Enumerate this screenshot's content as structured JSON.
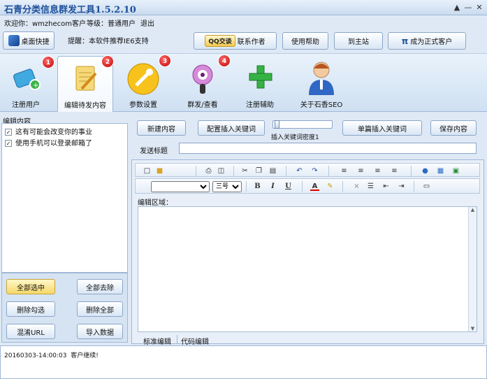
{
  "app": {
    "title": "石青分类信息群发工具1.5.2.10",
    "window_buttons": [
      "▲",
      "—",
      "✕"
    ]
  },
  "menubar": {
    "welcome": "欢迎你：wmzhecom客户",
    "level": "等级：普通用户",
    "logout": "退出"
  },
  "toolbar": {
    "desktop_shortcut": "桌面快捷",
    "hint": "提醒：本软件推荐IE6支持",
    "qq_badge": "QQ交谈",
    "contact_author": "联系作者",
    "help": "使用帮助",
    "home": "到主站",
    "become_customer": "成为正式客户",
    "pi_symbol": "π"
  },
  "tabs": [
    {
      "label": "注册用户",
      "badge": "1"
    },
    {
      "label": "编辑待发内容",
      "badge": "2"
    },
    {
      "label": "参数设置",
      "badge": "3"
    },
    {
      "label": "群发/查看",
      "badge": "4"
    },
    {
      "label": "注册辅助"
    },
    {
      "label": "关于石香SEO"
    }
  ],
  "left_panel": {
    "title": "编辑内容",
    "items": [
      "这有可能会改变你的事业",
      "使用手机可以登录邮箱了"
    ],
    "buttons": {
      "select_all": "全部选中",
      "clear_all": "全部去除",
      "delete_checked": "删除勾选",
      "delete_all": "删除全部",
      "filter_url": "混淆URL",
      "import_data": "导入数据"
    }
  },
  "editor": {
    "new_content": "新建内容",
    "config_keywords": "配置插入关键词",
    "keyword_density": "插入关键词密度1",
    "single_insert": "单篇插入关键词",
    "save_content": "保存内容",
    "subject_label": "发送标题",
    "subject_value": "",
    "area_label": "编辑区域：",
    "font_size": "三号",
    "font_name": "",
    "bold": "B",
    "italic": "I",
    "underline": "U",
    "text_color": "A",
    "tabs": [
      "标准编辑",
      "代码编辑"
    ]
  },
  "log": {
    "lines": [
      "20160303-14:00:03  客户继续!"
    ]
  },
  "colors": {
    "accent": "#1d4f9a",
    "badge": "#d40000",
    "frame": "#9fb8d6"
  }
}
